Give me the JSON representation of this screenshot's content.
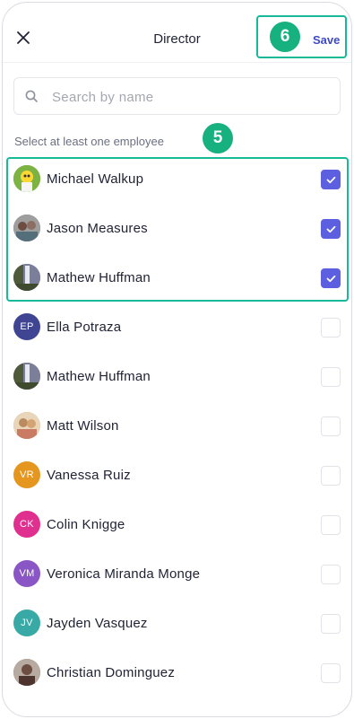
{
  "header": {
    "title": "Director",
    "save_label": "Save",
    "callout": "6"
  },
  "search": {
    "placeholder": "Search by name"
  },
  "hint": {
    "text": "Select at least one employee",
    "callout": "5"
  },
  "employees": [
    {
      "name": "Michael Walkup",
      "initials": "",
      "avatar": "photo-cartoon",
      "color": "#5a8f3a",
      "checked": true
    },
    {
      "name": "Jason Measures",
      "initials": "",
      "avatar": "photo-people",
      "color": "#6d6a68",
      "checked": true
    },
    {
      "name": "Mathew Huffman",
      "initials": "",
      "avatar": "photo-waterfall",
      "color": "#6f6f88",
      "checked": true
    },
    {
      "name": "Ella Potraza",
      "initials": "EP",
      "avatar": "initials",
      "color": "#3f4592",
      "checked": false
    },
    {
      "name": "Mathew Huffman",
      "initials": "",
      "avatar": "photo-waterfall",
      "color": "#6f6f88",
      "checked": false
    },
    {
      "name": "Matt Wilson",
      "initials": "",
      "avatar": "photo-warm",
      "color": "#c9a27a",
      "checked": false
    },
    {
      "name": "Vanessa Ruiz",
      "initials": "VR",
      "avatar": "initials",
      "color": "#e4961e",
      "checked": false
    },
    {
      "name": "Colin Knigge",
      "initials": "CK",
      "avatar": "initials",
      "color": "#e0308f",
      "checked": false
    },
    {
      "name": "Veronica Miranda Monge",
      "initials": "VM",
      "avatar": "initials",
      "color": "#8a55c4",
      "checked": false
    },
    {
      "name": "Jayden Vasquez",
      "initials": "JV",
      "avatar": "initials",
      "color": "#38a9a4",
      "checked": false
    },
    {
      "name": "Christian Dominguez",
      "initials": "",
      "avatar": "photo-portrait",
      "color": "#8a7466",
      "checked": false
    }
  ],
  "colors": {
    "accent": "#5b5fe0",
    "highlight": "#17b99a",
    "save": "#3e49c8"
  }
}
